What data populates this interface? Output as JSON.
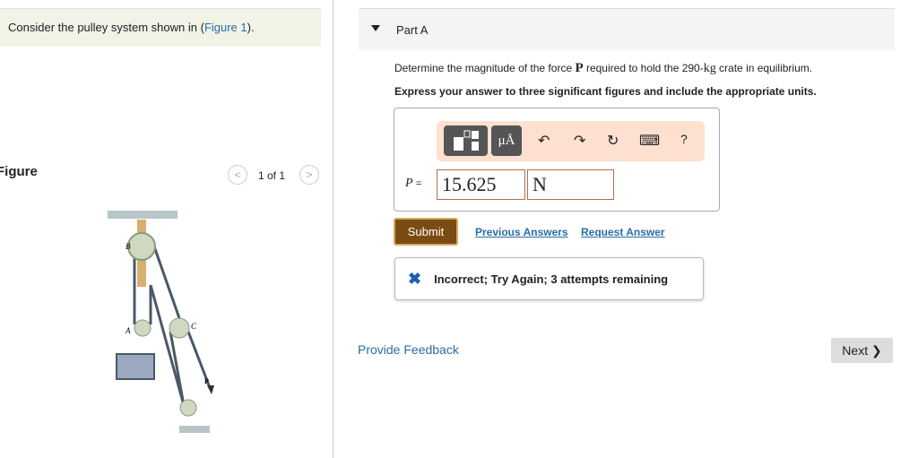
{
  "problem": {
    "prefix": "Consider the pulley system shown in (",
    "link": "Figure 1",
    "suffix": ")."
  },
  "figure": {
    "title": "Figure",
    "pager": "1 of 1",
    "prev": "<",
    "next": ">",
    "labels": {
      "b": "B",
      "a": "A",
      "c": "C",
      "p": "P"
    }
  },
  "partA": {
    "title": "Part A",
    "question_pre": "Determine the magnitude of the force ",
    "question_force": "P",
    "question_mid": " required to hold the 290-",
    "question_unit": "kg",
    "question_post": " crate in equilibrium.",
    "instruction": "Express your answer to three significant figures and include the appropriate units.",
    "toolbar": {
      "units": "μÅ",
      "undo": "↶",
      "redo": "↷",
      "reset": "↻",
      "keyboard": "⌨",
      "help": "?"
    },
    "variable": "P",
    "equals": "=",
    "value": "15.625",
    "unit": "N",
    "submit": "Submit",
    "previous_answers": "Previous Answers",
    "request_answer": "Request Answer",
    "feedback_icon": "✖",
    "feedback": "Incorrect; Try Again; 3 attempts remaining"
  },
  "footer": {
    "provide_feedback": "Provide Feedback",
    "next": "Next ❯"
  }
}
